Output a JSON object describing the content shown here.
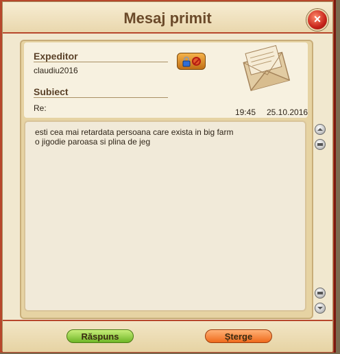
{
  "dialog": {
    "title": "Mesaj primit",
    "close_icon": "close-icon"
  },
  "header": {
    "sender_label": "Expeditor",
    "sender_value": "claudiu2016",
    "subject_label": "Subiect",
    "subject_value": "Re:",
    "time": "19:45",
    "date": "25.10.2016",
    "action_icons": [
      "lock-icon",
      "ban-icon"
    ],
    "illustration": "envelope-icon"
  },
  "message": {
    "text": "esti cea mai retardata persoana care exista in big farm\no jigodie paroasa si plina de jeg"
  },
  "scroll": {
    "icons": [
      "scroll-top-icon",
      "scroll-up-icon",
      "scroll-down-icon",
      "scroll-bottom-icon"
    ]
  },
  "footer": {
    "reply_label": "Răspuns",
    "delete_label": "Șterge"
  },
  "colors": {
    "frame_red": "#b7472b",
    "panel_cream": "#f1e8cf",
    "reply_green": "#7cc33a",
    "delete_orange": "#f0762a"
  }
}
